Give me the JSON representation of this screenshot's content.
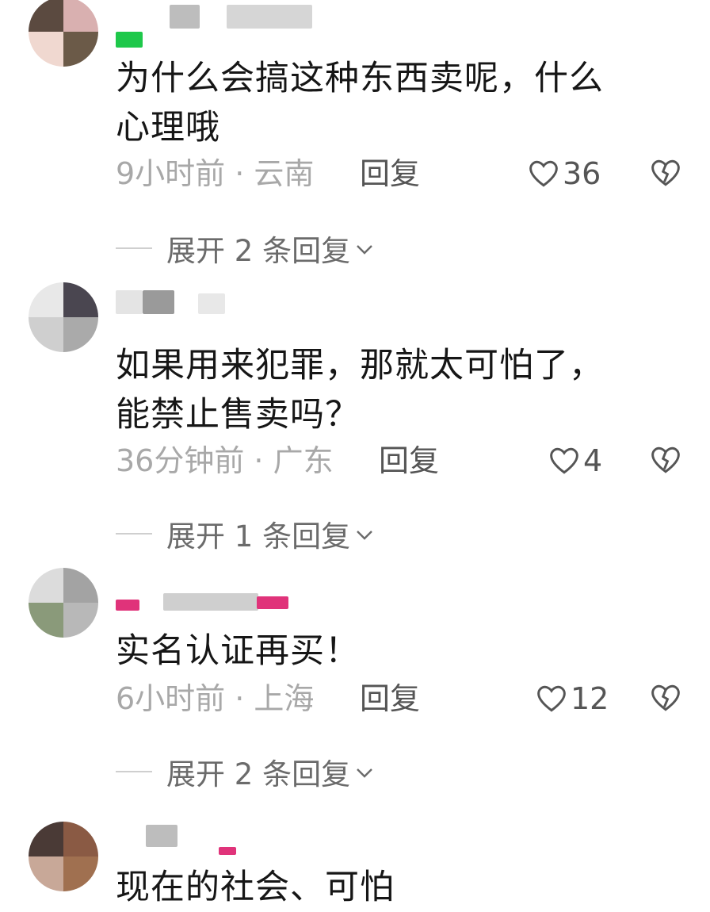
{
  "comments": [
    {
      "text": "为什么会搞这种东西卖呢，什么\n心理哦",
      "time": "9小时前 · 云南",
      "reply_label": "回复",
      "likes": "36",
      "expand_label": "展开 2 条回复",
      "avatar_colors": [
        "#5b4a40",
        "#d9b0b0",
        "#f0d8d0",
        "#6b5a48"
      ],
      "badge_color": "#1ec84a"
    },
    {
      "text": "如果用来犯罪，那就太可怕了，\n能禁止售卖吗？",
      "time": "36分钟前 · 广东",
      "reply_label": "回复",
      "likes": "4",
      "expand_label": "展开 1 条回复",
      "avatar_colors": [
        "#e8e8e8",
        "#4a4650",
        "#cfcfcf",
        "#aaaaaa"
      ]
    },
    {
      "text": "实名认证再买！",
      "time": "6小时前 · 上海",
      "reply_label": "回复",
      "likes": "12",
      "expand_label": "展开 2 条回复",
      "avatar_colors": [
        "#dcdcdc",
        "#a3a3a3",
        "#8a9a7a",
        "#b8b8b8"
      ],
      "badge_color": "#e0337a"
    },
    {
      "text": "现在的社会、可怕",
      "avatar_colors": [
        "#4a3a36",
        "#8a5a44",
        "#c8a898",
        "#a07050"
      ],
      "badge_color": "#e0337a"
    }
  ],
  "colors": {
    "text": "#161616",
    "meta": "#a8a8a8",
    "action": "#555555"
  }
}
